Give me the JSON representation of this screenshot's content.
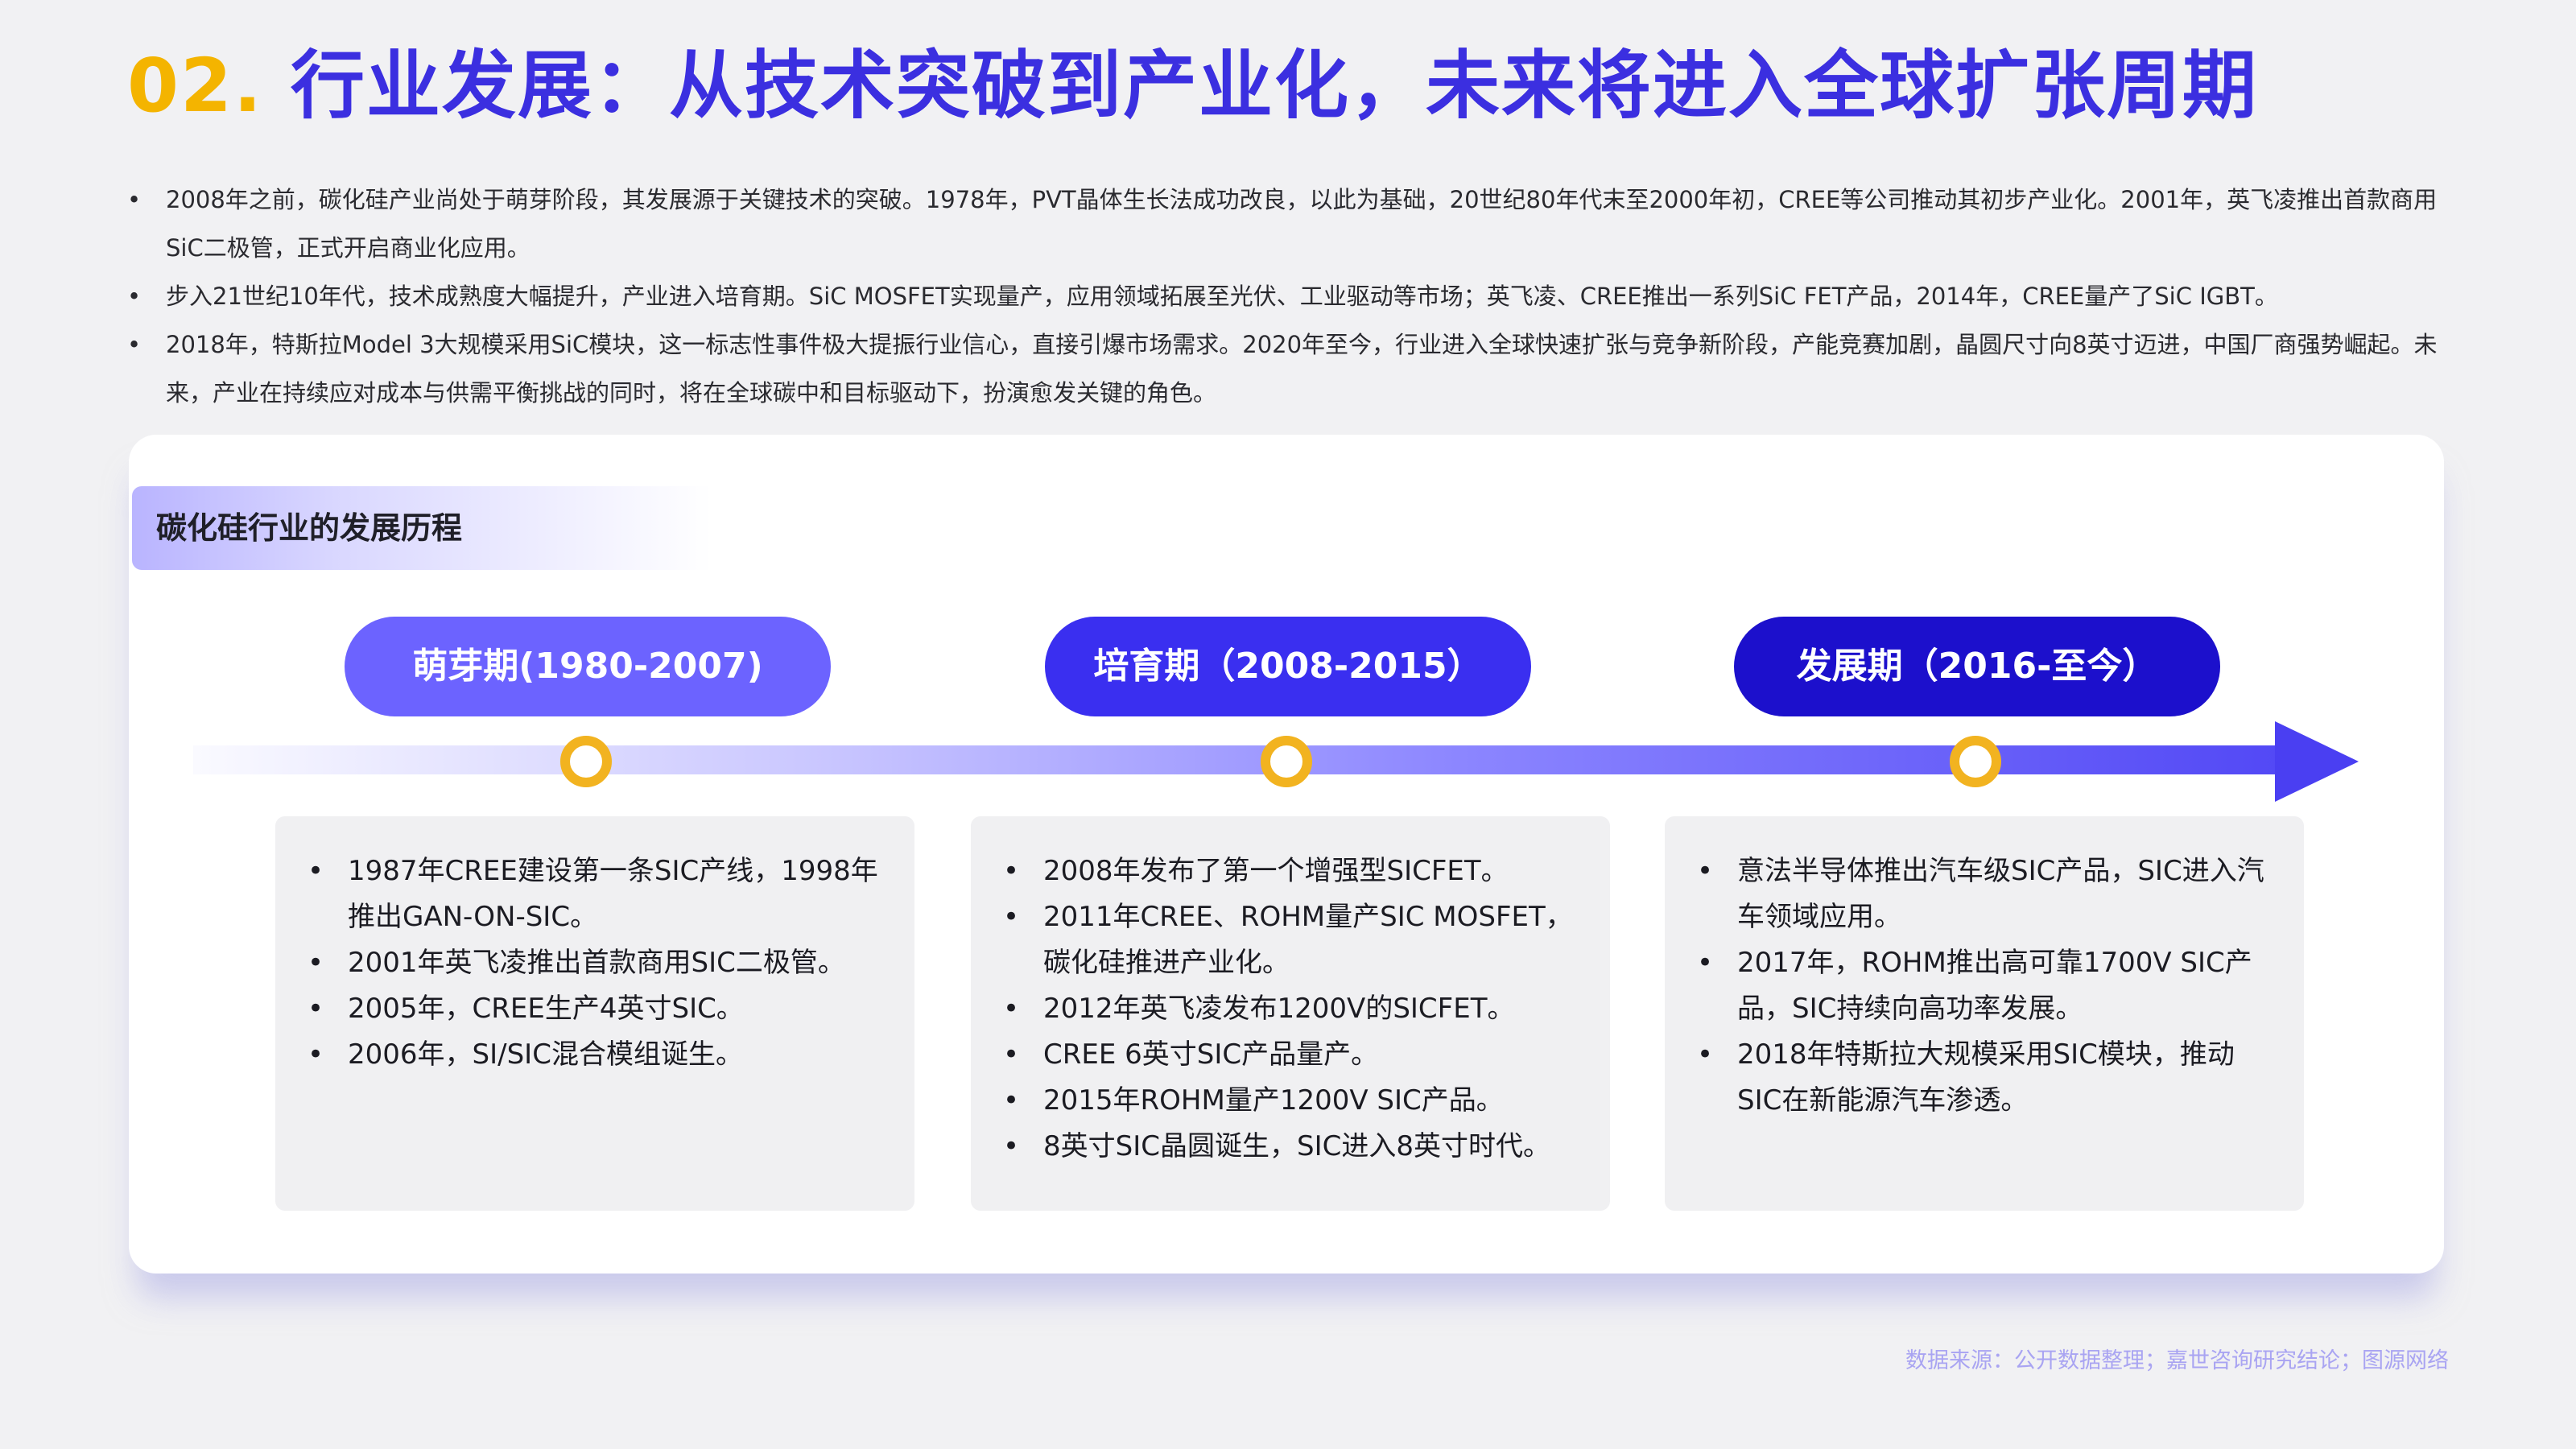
{
  "title": {
    "number": "02.",
    "text": "行业发展：从技术突破到产业化，未来将进入全球扩张周期"
  },
  "intro": [
    "2008年之前，碳化硅产业尚处于萌芽阶段，其发展源于关键技术的突破。1978年，PVT晶体生长法成功改良，以此为基础，20世纪80年代末至2000年初，CREE等公司推动其初步产业化。2001年，英飞凌推出首款商用SiC二极管，正式开启商业化应用。",
    "步入21世纪10年代，技术成熟度大幅提升，产业进入培育期。SiC MOSFET实现量产，应用领域拓展至光伏、工业驱动等市场；英飞凌、CREE推出一系列SiC FET产品，2014年，CREE量产了SiC IGBT。",
    "2018年，特斯拉Model 3大规模采用SiC模块，这一标志性事件极大提振行业信心，直接引爆市场需求。2020年至今，行业进入全球快速扩张与竞争新阶段，产能竞赛加剧，晶圆尺寸向8英寸迈进，中国厂商强势崛起。未来，产业在持续应对成本与供需平衡挑战的同时，将在全球碳中和目标驱动下，扮演愈发关键的角色。"
  ],
  "section_tag": "碳化硅行业的发展历程",
  "phases": [
    {
      "label": "萌芽期(1980-2007)",
      "color": "#6c63ff",
      "items": [
        "1987年CREE建设第一条SIC产线，1998年推出GAN-ON-SIC。",
        "2001年英飞凌推出首款商用SIC二极管。",
        "2005年，CREE生产4英寸SIC。",
        "2006年，SI/SIC混合模组诞生。"
      ]
    },
    {
      "label": "培育期（2008-2015）",
      "color": "#3a2ff0",
      "items": [
        "2008年发布了第一个增强型SICFET。",
        "2011年CREE、ROHM量产SIC MOSFET，碳化硅推进产业化。",
        "2012年英飞凌发布1200V的SICFET。",
        "CREE 6英寸SIC产品量产。",
        "2015年ROHM量产1200V SIC产品。",
        "8英寸SIC晶圆诞生，SIC进入8英寸时代。"
      ]
    },
    {
      "label": "发展期（2016-至今）",
      "color": "#1c10cc",
      "items": [
        "意法半导体推出汽车级SIC产品，SIC进入汽车领域应用。",
        "2017年，ROHM推出高可靠1700V SIC产品，SIC持续向高功率发展。",
        "2018年特斯拉大规模采用SIC模块，推动SIC在新能源汽车渗透。"
      ]
    }
  ],
  "source": "数据来源：公开数据整理；嘉世咨询研究结论；图源网络"
}
